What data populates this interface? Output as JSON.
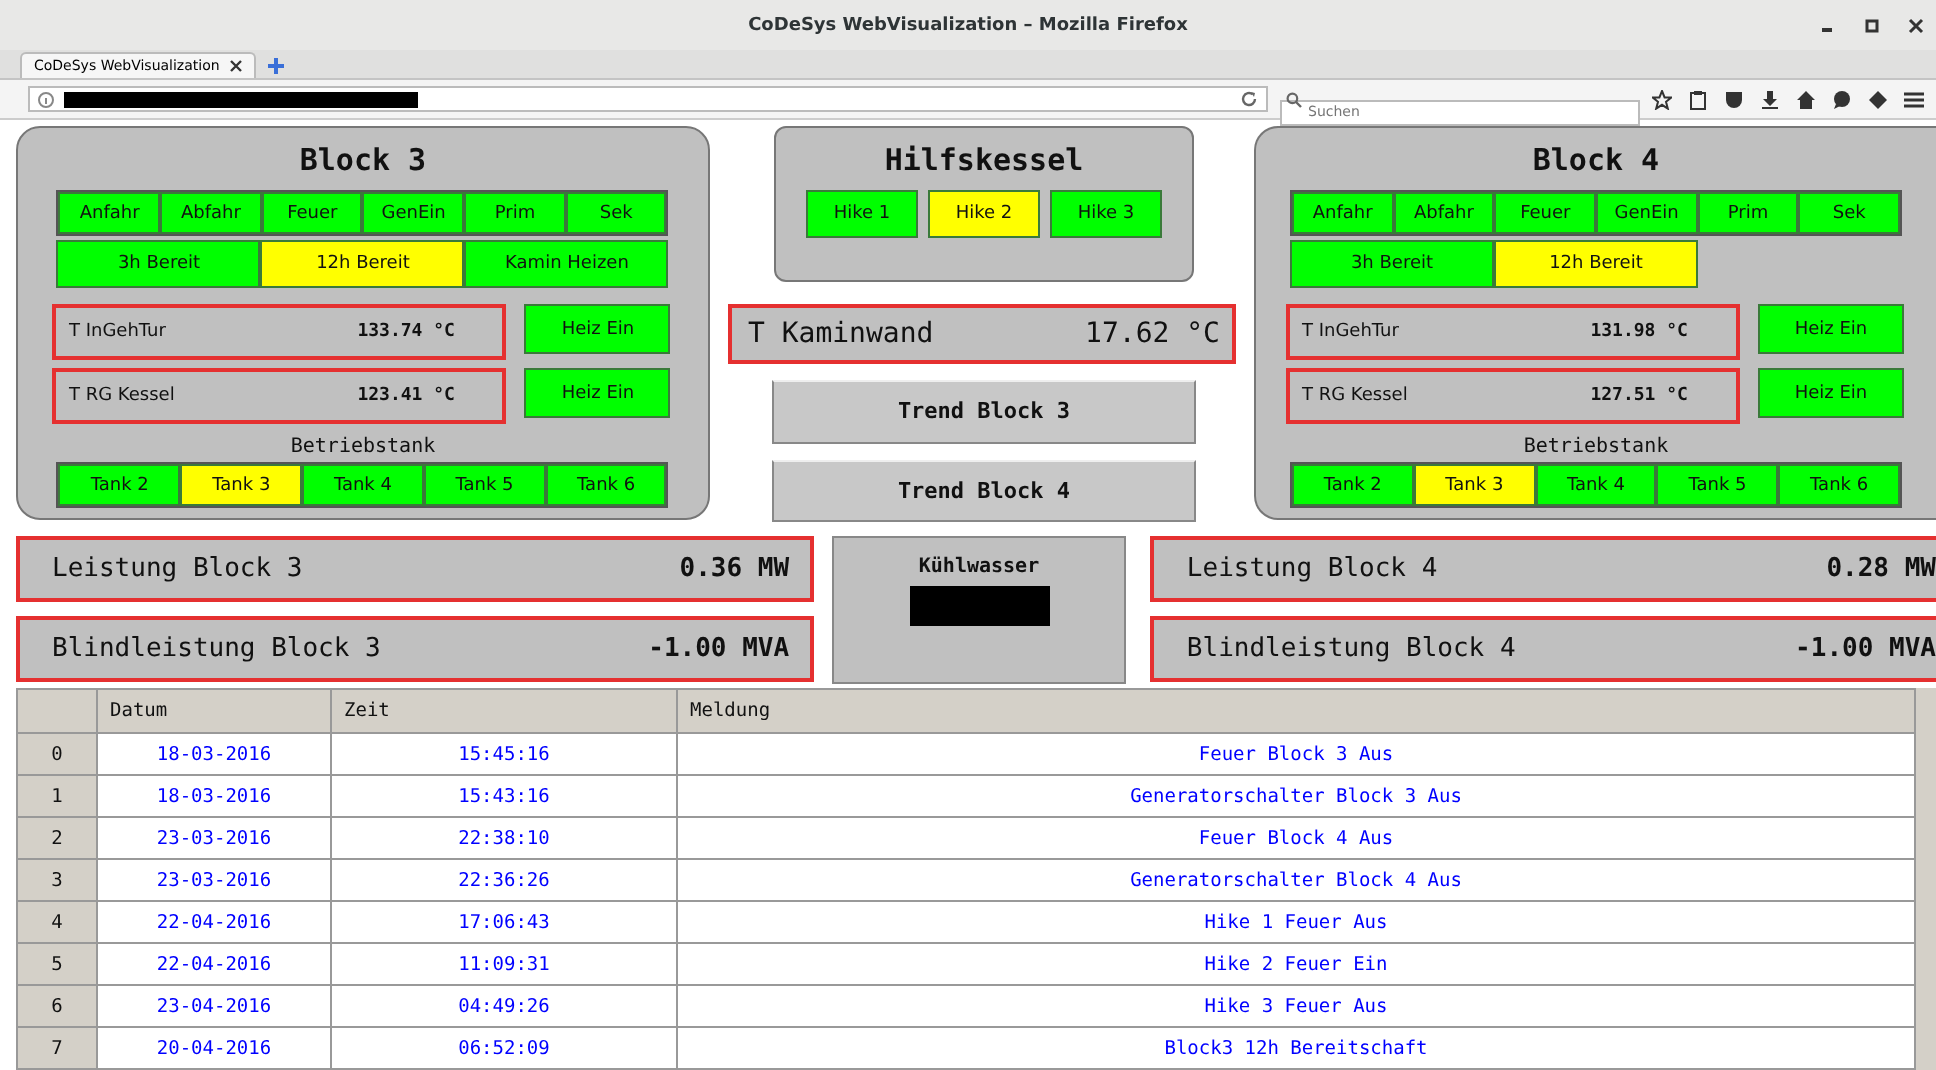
{
  "window": {
    "title": "CoDeSys WebVisualization – Mozilla Firefox"
  },
  "tabs": [
    {
      "label": "CoDeSys WebVisualization",
      "selected": true
    }
  ],
  "search": {
    "placeholder": "Suchen"
  },
  "blocks": [
    {
      "title": "Block 3",
      "indicators": [
        {
          "label": "Anfahr",
          "active": false
        },
        {
          "label": "Abfahr",
          "active": false
        },
        {
          "label": "Feuer",
          "active": false
        },
        {
          "label": "GenEin",
          "active": false
        },
        {
          "label": "Prim",
          "active": false
        },
        {
          "label": "Sek",
          "active": false
        }
      ],
      "modes": [
        {
          "label": "3h Bereit",
          "active": false
        },
        {
          "label": "12h Bereit",
          "active": true
        },
        {
          "label": "Kamin Heizen",
          "active": false
        }
      ],
      "temps": [
        {
          "label": "T InGehTur",
          "value": "133.74 °C",
          "button": "Heiz Ein"
        },
        {
          "label": "T RG Kessel",
          "value": "123.41 °C",
          "button": "Heiz Ein"
        }
      ],
      "tank_title": "Betriebstank",
      "tanks": [
        {
          "label": "Tank 2",
          "active": false
        },
        {
          "label": "Tank 3",
          "active": true
        },
        {
          "label": "Tank 4",
          "active": false
        },
        {
          "label": "Tank 5",
          "active": false
        },
        {
          "label": "Tank 6",
          "active": false
        }
      ]
    },
    {
      "title": "Block 4",
      "indicators": [
        {
          "label": "Anfahr",
          "active": false
        },
        {
          "label": "Abfahr",
          "active": false
        },
        {
          "label": "Feuer",
          "active": false
        },
        {
          "label": "GenEin",
          "active": false
        },
        {
          "label": "Prim",
          "active": false
        },
        {
          "label": "Sek",
          "active": false
        }
      ],
      "modes": [
        {
          "label": "3h Bereit",
          "active": false
        },
        {
          "label": "12h Bereit",
          "active": true
        }
      ],
      "temps": [
        {
          "label": "T InGehTur",
          "value": "131.98 °C",
          "button": "Heiz Ein"
        },
        {
          "label": "T RG Kessel",
          "value": "127.51 °C",
          "button": "Heiz Ein"
        }
      ],
      "tank_title": "Betriebstank",
      "tanks": [
        {
          "label": "Tank 2",
          "active": false
        },
        {
          "label": "Tank 3",
          "active": true
        },
        {
          "label": "Tank 4",
          "active": false
        },
        {
          "label": "Tank 5",
          "active": false
        },
        {
          "label": "Tank 6",
          "active": false
        }
      ]
    }
  ],
  "hilfskessel": {
    "title": "Hilfskessel",
    "units": [
      {
        "label": "Hike 1",
        "active": false
      },
      {
        "label": "Hike 2",
        "active": true
      },
      {
        "label": "Hike 3",
        "active": false
      }
    ]
  },
  "kaminwand": {
    "label": "T Kaminwand",
    "value": "17.62 °C"
  },
  "trend_buttons": [
    "Trend Block 3",
    "Trend Block 4"
  ],
  "power_left": [
    {
      "label": "Leistung Block 3",
      "value": "0.36 MW"
    },
    {
      "label": "Blindleistung Block 3",
      "value": "-1.00 MVA"
    }
  ],
  "kuehlwasser": {
    "label": "Kühlwasser"
  },
  "power_right": [
    {
      "label": "Leistung Block 4",
      "value": "0.28 MW"
    },
    {
      "label": "Blindleistung Block 4",
      "value": "-1.00 MVA"
    }
  ],
  "table": {
    "columns": [
      "Datum",
      "Zeit",
      "Meldung"
    ],
    "rows": [
      {
        "index": "0",
        "datum": "18-03-2016",
        "zeit": "15:45:16",
        "meldung": "Feuer Block 3 Aus"
      },
      {
        "index": "1",
        "datum": "18-03-2016",
        "zeit": "15:43:16",
        "meldung": "Generatorschalter Block 3 Aus"
      },
      {
        "index": "2",
        "datum": "23-03-2016",
        "zeit": "22:38:10",
        "meldung": "Feuer Block 4 Aus"
      },
      {
        "index": "3",
        "datum": "23-03-2016",
        "zeit": "22:36:26",
        "meldung": "Generatorschalter Block 4 Aus"
      },
      {
        "index": "4",
        "datum": "22-04-2016",
        "zeit": "17:06:43",
        "meldung": "Hike 1 Feuer Aus"
      },
      {
        "index": "5",
        "datum": "22-04-2016",
        "zeit": "11:09:31",
        "meldung": "Hike 2 Feuer Ein"
      },
      {
        "index": "6",
        "datum": "23-04-2016",
        "zeit": "04:49:26",
        "meldung": "Hike 3 Feuer Aus"
      },
      {
        "index": "7",
        "datum": "20-04-2016",
        "zeit": "06:52:09",
        "meldung": "Block3 12h Bereitschaft"
      }
    ]
  }
}
